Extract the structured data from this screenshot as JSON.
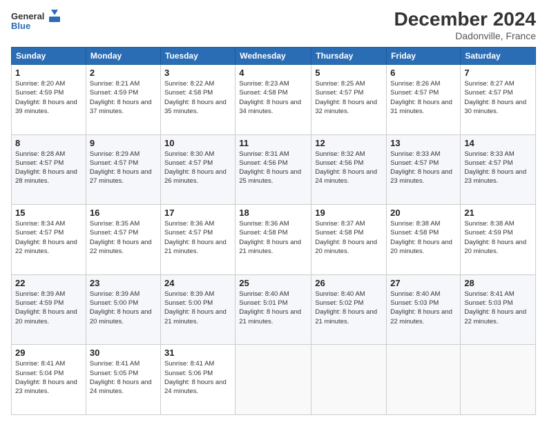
{
  "logo": {
    "line1": "General",
    "line2": "Blue"
  },
  "header": {
    "title": "December 2024",
    "location": "Dadonville, France"
  },
  "weekdays": [
    "Sunday",
    "Monday",
    "Tuesday",
    "Wednesday",
    "Thursday",
    "Friday",
    "Saturday"
  ],
  "weeks": [
    [
      {
        "day": "1",
        "sunrise": "8:20 AM",
        "sunset": "4:59 PM",
        "daylight": "8 hours and 39 minutes."
      },
      {
        "day": "2",
        "sunrise": "8:21 AM",
        "sunset": "4:59 PM",
        "daylight": "8 hours and 37 minutes."
      },
      {
        "day": "3",
        "sunrise": "8:22 AM",
        "sunset": "4:58 PM",
        "daylight": "8 hours and 35 minutes."
      },
      {
        "day": "4",
        "sunrise": "8:23 AM",
        "sunset": "4:58 PM",
        "daylight": "8 hours and 34 minutes."
      },
      {
        "day": "5",
        "sunrise": "8:25 AM",
        "sunset": "4:57 PM",
        "daylight": "8 hours and 32 minutes."
      },
      {
        "day": "6",
        "sunrise": "8:26 AM",
        "sunset": "4:57 PM",
        "daylight": "8 hours and 31 minutes."
      },
      {
        "day": "7",
        "sunrise": "8:27 AM",
        "sunset": "4:57 PM",
        "daylight": "8 hours and 30 minutes."
      }
    ],
    [
      {
        "day": "8",
        "sunrise": "8:28 AM",
        "sunset": "4:57 PM",
        "daylight": "8 hours and 28 minutes."
      },
      {
        "day": "9",
        "sunrise": "8:29 AM",
        "sunset": "4:57 PM",
        "daylight": "8 hours and 27 minutes."
      },
      {
        "day": "10",
        "sunrise": "8:30 AM",
        "sunset": "4:57 PM",
        "daylight": "8 hours and 26 minutes."
      },
      {
        "day": "11",
        "sunrise": "8:31 AM",
        "sunset": "4:56 PM",
        "daylight": "8 hours and 25 minutes."
      },
      {
        "day": "12",
        "sunrise": "8:32 AM",
        "sunset": "4:56 PM",
        "daylight": "8 hours and 24 minutes."
      },
      {
        "day": "13",
        "sunrise": "8:33 AM",
        "sunset": "4:57 PM",
        "daylight": "8 hours and 23 minutes."
      },
      {
        "day": "14",
        "sunrise": "8:33 AM",
        "sunset": "4:57 PM",
        "daylight": "8 hours and 23 minutes."
      }
    ],
    [
      {
        "day": "15",
        "sunrise": "8:34 AM",
        "sunset": "4:57 PM",
        "daylight": "8 hours and 22 minutes."
      },
      {
        "day": "16",
        "sunrise": "8:35 AM",
        "sunset": "4:57 PM",
        "daylight": "8 hours and 22 minutes."
      },
      {
        "day": "17",
        "sunrise": "8:36 AM",
        "sunset": "4:57 PM",
        "daylight": "8 hours and 21 minutes."
      },
      {
        "day": "18",
        "sunrise": "8:36 AM",
        "sunset": "4:58 PM",
        "daylight": "8 hours and 21 minutes."
      },
      {
        "day": "19",
        "sunrise": "8:37 AM",
        "sunset": "4:58 PM",
        "daylight": "8 hours and 20 minutes."
      },
      {
        "day": "20",
        "sunrise": "8:38 AM",
        "sunset": "4:58 PM",
        "daylight": "8 hours and 20 minutes."
      },
      {
        "day": "21",
        "sunrise": "8:38 AM",
        "sunset": "4:59 PM",
        "daylight": "8 hours and 20 minutes."
      }
    ],
    [
      {
        "day": "22",
        "sunrise": "8:39 AM",
        "sunset": "4:59 PM",
        "daylight": "8 hours and 20 minutes."
      },
      {
        "day": "23",
        "sunrise": "8:39 AM",
        "sunset": "5:00 PM",
        "daylight": "8 hours and 20 minutes."
      },
      {
        "day": "24",
        "sunrise": "8:39 AM",
        "sunset": "5:00 PM",
        "daylight": "8 hours and 21 minutes."
      },
      {
        "day": "25",
        "sunrise": "8:40 AM",
        "sunset": "5:01 PM",
        "daylight": "8 hours and 21 minutes."
      },
      {
        "day": "26",
        "sunrise": "8:40 AM",
        "sunset": "5:02 PM",
        "daylight": "8 hours and 21 minutes."
      },
      {
        "day": "27",
        "sunrise": "8:40 AM",
        "sunset": "5:03 PM",
        "daylight": "8 hours and 22 minutes."
      },
      {
        "day": "28",
        "sunrise": "8:41 AM",
        "sunset": "5:03 PM",
        "daylight": "8 hours and 22 minutes."
      }
    ],
    [
      {
        "day": "29",
        "sunrise": "8:41 AM",
        "sunset": "5:04 PM",
        "daylight": "8 hours and 23 minutes."
      },
      {
        "day": "30",
        "sunrise": "8:41 AM",
        "sunset": "5:05 PM",
        "daylight": "8 hours and 24 minutes."
      },
      {
        "day": "31",
        "sunrise": "8:41 AM",
        "sunset": "5:06 PM",
        "daylight": "8 hours and 24 minutes."
      },
      null,
      null,
      null,
      null
    ]
  ],
  "labels": {
    "sunrise": "Sunrise:",
    "sunset": "Sunset:",
    "daylight": "Daylight:"
  }
}
